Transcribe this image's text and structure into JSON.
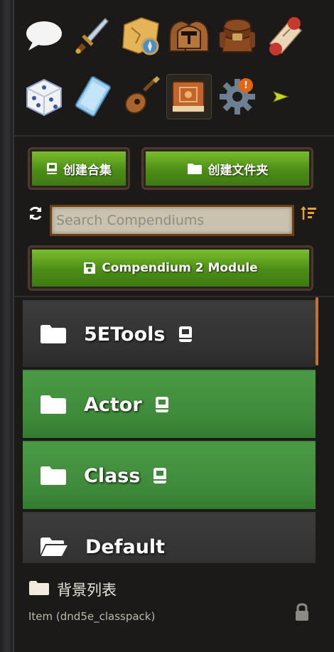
{
  "tabs": {
    "items": [
      {
        "name": "chat-tab",
        "icon": "chat-bubble-icon"
      },
      {
        "name": "combat-tab",
        "icon": "sword-icon"
      },
      {
        "name": "scenes-tab",
        "icon": "map-compass-icon"
      },
      {
        "name": "actors-tab",
        "icon": "knight-helmets-icon"
      },
      {
        "name": "items-tab",
        "icon": "backpack-icon"
      },
      {
        "name": "journal-tab",
        "icon": "scroll-icon"
      },
      {
        "name": "tables-tab",
        "icon": "dice-icon"
      },
      {
        "name": "cards-tab",
        "icon": "card-icon"
      },
      {
        "name": "playlists-tab",
        "icon": "lute-icon"
      },
      {
        "name": "compendium-tab",
        "icon": "compendium-book-icon",
        "active": true
      },
      {
        "name": "settings-tab",
        "icon": "gear-icon",
        "badge": "!"
      },
      {
        "name": "collapse-tab",
        "icon": "play-arrow-icon"
      }
    ]
  },
  "actions": {
    "create_compendium": "创建合集",
    "create_folder": "创建文件夹",
    "compendium_module": "Compendium 2 Module"
  },
  "search": {
    "placeholder": "Search Compendiums"
  },
  "directory": {
    "folders": [
      {
        "label": "5ETools",
        "style": "gray",
        "open": false
      },
      {
        "label": "Actor",
        "style": "green",
        "open": false
      },
      {
        "label": "Class",
        "style": "green",
        "open": false
      },
      {
        "label": "Default",
        "style": "gray",
        "open": true
      }
    ]
  },
  "footer": {
    "pack_title": "背景列表",
    "pack_subtitle": "Item (dnd5e_classpack)"
  },
  "colors": {
    "button_green": "#5a9e1f",
    "folder_green": "#418d3b",
    "folder_gray": "#353535",
    "accent_orange": "#e66412",
    "sidebar_bg": "#1b1a18"
  }
}
